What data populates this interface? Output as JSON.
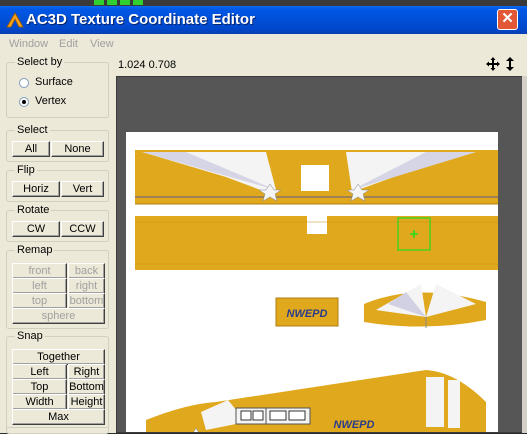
{
  "window": {
    "title": "AC3D Texture Coordinate Editor",
    "close_glyph": "✕"
  },
  "menu": [
    "Window",
    "Edit",
    "View"
  ],
  "select_by": {
    "label": "Select by",
    "options": [
      "Surface",
      "Vertex"
    ],
    "selected": "Vertex"
  },
  "select": {
    "label": "Select",
    "buttons": [
      "All",
      "None"
    ]
  },
  "flip": {
    "label": "Flip",
    "buttons": [
      "Horiz",
      "Vert"
    ]
  },
  "rotate": {
    "label": "Rotate",
    "buttons": [
      "CW",
      "CCW"
    ]
  },
  "remap": {
    "label": "Remap",
    "buttons": [
      "front",
      "back",
      "left",
      "right",
      "top",
      "bottom",
      "sphere"
    ]
  },
  "snap": {
    "label": "Snap",
    "buttons": [
      "Together",
      "Left",
      "Right",
      "Top",
      "Bottom",
      "Width",
      "Height",
      "Max"
    ]
  },
  "status": {
    "coords": "1.024 0.708"
  },
  "texture": {
    "labels": [
      "NWEPD",
      "NWEPD"
    ],
    "colors": {
      "yellow": "#e0a81c",
      "white": "#f4f4f4",
      "selection": "#22dd22"
    }
  },
  "icons": [
    "app-logo-icon",
    "close-icon",
    "move-icon",
    "vertical-move-icon"
  ]
}
